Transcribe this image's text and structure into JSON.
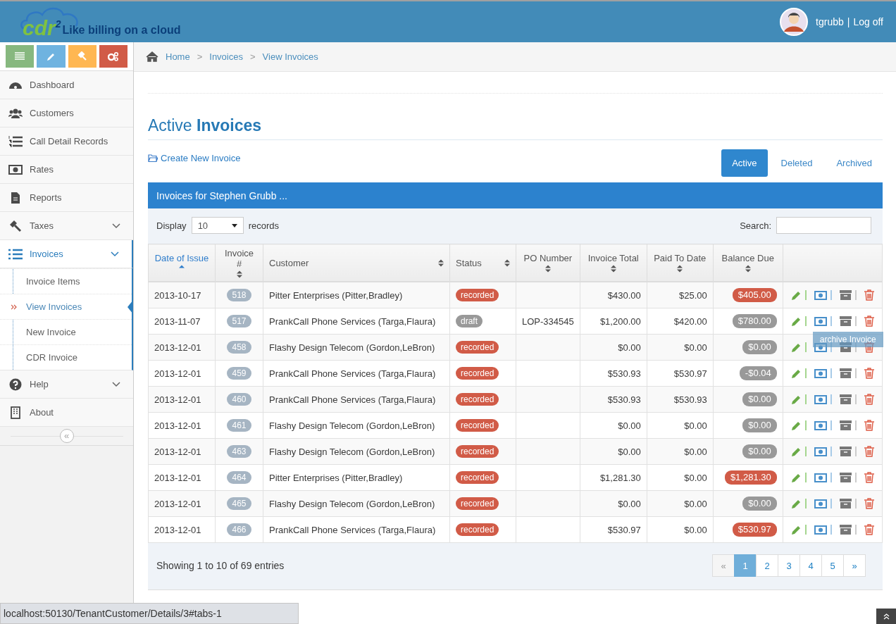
{
  "header": {
    "logo": "cdr$^{2}$",
    "tagline": "Like billing on a cloud",
    "user": "tgrubb",
    "separator": "|",
    "logoff": "Log off"
  },
  "shortcuts": [
    {
      "color": "#87b87f"
    },
    {
      "color": "#6fb3e0"
    },
    {
      "color": "#ffb752"
    },
    {
      "color": "#d15b47"
    }
  ],
  "sidebar": {
    "items": [
      {
        "label": "Dashboard",
        "selected": false,
        "expandable": false
      },
      {
        "label": "Customers",
        "selected": false,
        "expandable": false
      },
      {
        "label": "Call Detail Records",
        "selected": false,
        "expandable": false
      },
      {
        "label": "Rates",
        "selected": false,
        "expandable": false
      },
      {
        "label": "Reports",
        "selected": false,
        "expandable": false
      },
      {
        "label": "Taxes",
        "selected": false,
        "expandable": true
      },
      {
        "label": "Invoices",
        "selected": true,
        "expandable": true,
        "children": [
          {
            "label": "Invoice Items",
            "selected": false
          },
          {
            "label": "View Invoices",
            "selected": true
          },
          {
            "label": "New Invoice",
            "selected": false
          },
          {
            "label": "CDR Invoice",
            "selected": false
          }
        ]
      },
      {
        "label": "Help",
        "selected": false,
        "expandable": true
      },
      {
        "label": "About",
        "selected": false,
        "expandable": false
      }
    ],
    "collapse": "«"
  },
  "breadcrumb": [
    {
      "label": "Home",
      "separator": ">"
    },
    {
      "label": "Invoices",
      "separator": ">"
    },
    {
      "label": "View Invoices"
    }
  ],
  "title": "Active **Invoices**",
  "create_link": "Create New Invoice",
  "tabs": [
    {
      "label": "Active",
      "selected": true
    },
    {
      "label": "Deleted",
      "selected": false
    },
    {
      "label": "Archived",
      "selected": false
    }
  ],
  "panel": {
    "title": "Invoices for Stephen Grubb ...",
    "display_label": "Display",
    "display_value": "10",
    "records_label": "records",
    "search_label": "Search:"
  },
  "table": {
    "columns": [
      {
        "label": "Date of Issue",
        "sorted": true
      },
      {
        "label": "Invoice #",
        "sorted": false
      },
      {
        "label": "Customer",
        "sorted": false
      },
      {
        "label": "Status",
        "sorted": false
      },
      {
        "label": "PO Number",
        "sorted": false
      },
      {
        "label": "Invoice Total",
        "sorted": false
      },
      {
        "label": "Paid To Date",
        "sorted": false
      },
      {
        "label": "Balance Due",
        "sorted": false
      }
    ],
    "rows": [
      {
        "date": "2013-10-17",
        "number": "518",
        "customer": "Pitter Enterprises (Pitter,Bradley)",
        "status": {
          "text": "recorded",
          "color": "#d15b47"
        },
        "total": "$430.00",
        "paid": "$25.00",
        "balance": {
          "text": "$405.00",
          "color": "#d15b47"
        }
      },
      {
        "date": "2013-11-07",
        "number": "517",
        "customer": "PrankCall Phone Services (Targa,Flaura)",
        "status": {
          "text": "draft",
          "color": "#999999"
        },
        "po": "LOP-334545",
        "total": "$1,200.00",
        "paid": "$420.00",
        "balance": {
          "text": "$780.00",
          "color": "#999999"
        },
        "tooltip": "archive Invoice"
      },
      {
        "date": "2013-12-01",
        "number": "458",
        "customer": "Flashy Design Telecom (Gordon,LeBron)",
        "status": {
          "text": "recorded",
          "color": "#d15b47"
        },
        "total": "$0.00",
        "paid": "$0.00",
        "balance": {
          "text": "$0.00",
          "color": "#999999"
        }
      },
      {
        "date": "2013-12-01",
        "number": "459",
        "customer": "PrankCall Phone Services (Targa,Flaura)",
        "status": {
          "text": "recorded",
          "color": "#d15b47"
        },
        "total": "$530.93",
        "paid": "$530.97",
        "balance": {
          "text": "-$0.04",
          "color": "#999999"
        }
      },
      {
        "date": "2013-12-01",
        "number": "460",
        "customer": "PrankCall Phone Services (Targa,Flaura)",
        "status": {
          "text": "recorded",
          "color": "#d15b47"
        },
        "total": "$530.93",
        "paid": "$530.93",
        "balance": {
          "text": "$0.00",
          "color": "#999999"
        }
      },
      {
        "date": "2013-12-01",
        "number": "461",
        "customer": "Flashy Design Telecom (Gordon,LeBron)",
        "status": {
          "text": "recorded",
          "color": "#d15b47"
        },
        "total": "$0.00",
        "paid": "$0.00",
        "balance": {
          "text": "$0.00",
          "color": "#999999"
        }
      },
      {
        "date": "2013-12-01",
        "number": "463",
        "customer": "Flashy Design Telecom (Gordon,LeBron)",
        "status": {
          "text": "recorded",
          "color": "#d15b47"
        },
        "total": "$0.00",
        "paid": "$0.00",
        "balance": {
          "text": "$0.00",
          "color": "#999999"
        }
      },
      {
        "date": "2013-12-01",
        "number": "464",
        "customer": "Pitter Enterprises (Pitter,Bradley)",
        "status": {
          "text": "recorded",
          "color": "#d15b47"
        },
        "total": "$1,281.30",
        "paid": "$0.00",
        "balance": {
          "text": "$1,281.30",
          "color": "#d15b47"
        }
      },
      {
        "date": "2013-12-01",
        "number": "465",
        "customer": "Flashy Design Telecom (Gordon,LeBron)",
        "status": {
          "text": "recorded",
          "color": "#d15b47"
        },
        "total": "$0.00",
        "paid": "$0.00",
        "balance": {
          "text": "$0.00",
          "color": "#999999"
        }
      },
      {
        "date": "2013-12-01",
        "number": "466",
        "customer": "PrankCall Phone Services (Targa,Flaura)",
        "status": {
          "text": "recorded",
          "color": "#d15b47"
        },
        "total": "$530.97",
        "paid": "$0.00",
        "balance": {
          "text": "$530.97",
          "color": "#d15b47"
        }
      }
    ]
  },
  "info": "Showing 1 to 10 of 69 entries",
  "pagination": [
    {
      "label": "«",
      "selected": false,
      "disabled": true
    },
    {
      "label": "1",
      "selected": true,
      "disabled": false
    },
    {
      "label": "2",
      "selected": false,
      "disabled": false
    },
    {
      "label": "3",
      "selected": false,
      "disabled": false
    },
    {
      "label": "4",
      "selected": false,
      "disabled": false
    },
    {
      "label": "5",
      "selected": false,
      "disabled": false
    },
    {
      "label": "»",
      "selected": false,
      "disabled": false
    }
  ],
  "status_bar": "localhost:50130/TenantCustomer/Details/3#tabs-1"
}
